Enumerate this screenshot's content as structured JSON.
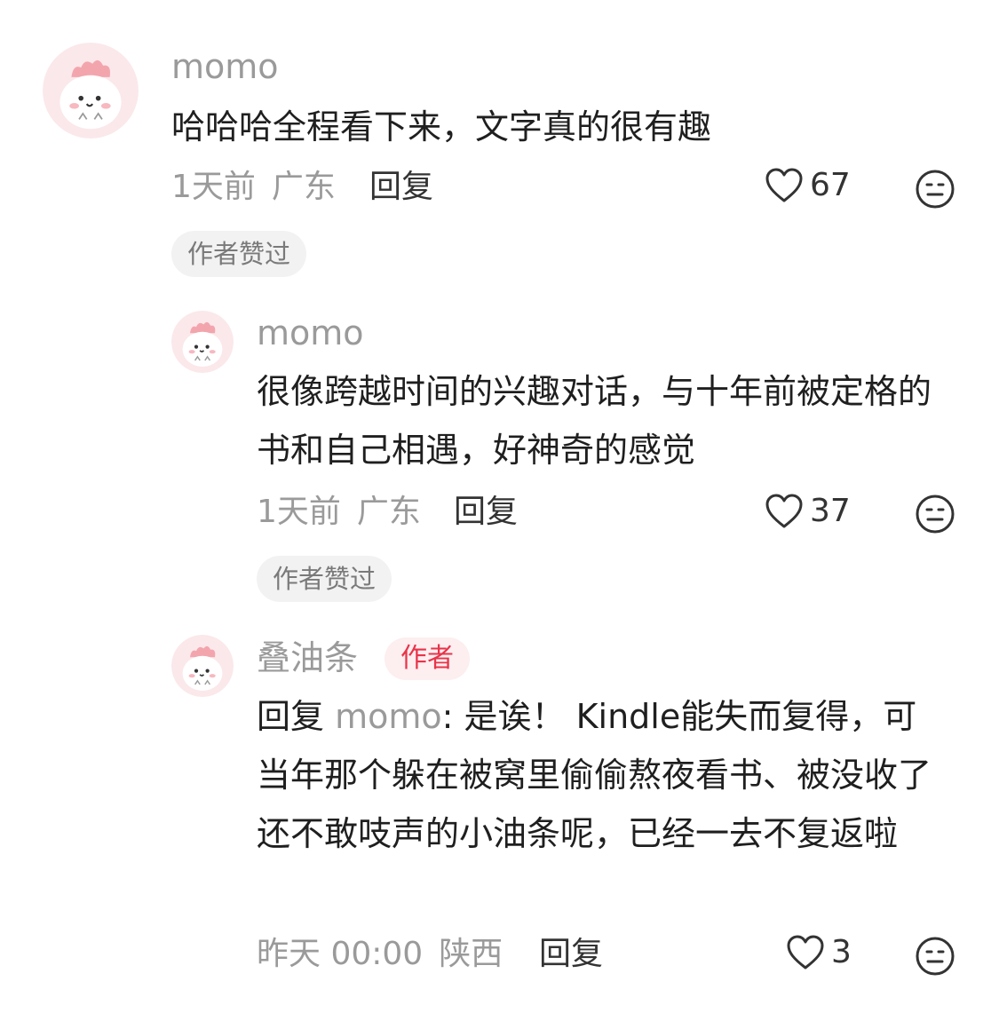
{
  "comments": [
    {
      "username": "momo",
      "text": "哈哈哈全程看下来，文字真的很有趣",
      "time": "1天前",
      "location": "广东",
      "reply_label": "回复",
      "likes": "67",
      "badge": "作者赞过"
    },
    {
      "username": "momo",
      "text": "很像跨越时间的兴趣对话，与十年前被定格的书和自己相遇，好神奇的感觉",
      "time": "1天前",
      "location": "广东",
      "reply_label": "回复",
      "likes": "37",
      "badge": "作者赞过"
    },
    {
      "username": "叠油条",
      "author_tag": "作者",
      "reply_prefix": "回复 ",
      "reply_to": "momo",
      "text": ": 是诶！ Kindle能失而复得，可当年那个躲在被窝里偷偷熬夜看书、被没收了还不敢吱声的小油条呢，已经一去不复返啦",
      "time": "昨天 00:00",
      "location": "陕西",
      "reply_label": "回复",
      "likes": "3"
    }
  ],
  "icons": {
    "like": "heart-outline-icon",
    "dislike": "neutral-face-icon",
    "avatar": "pink-dinosaur-avatar"
  },
  "colors": {
    "author_tag_text": "#e8344a",
    "author_tag_bg": "#fdeef0",
    "muted_text": "#9a9a9a",
    "badge_bg": "#f2f2f2"
  }
}
